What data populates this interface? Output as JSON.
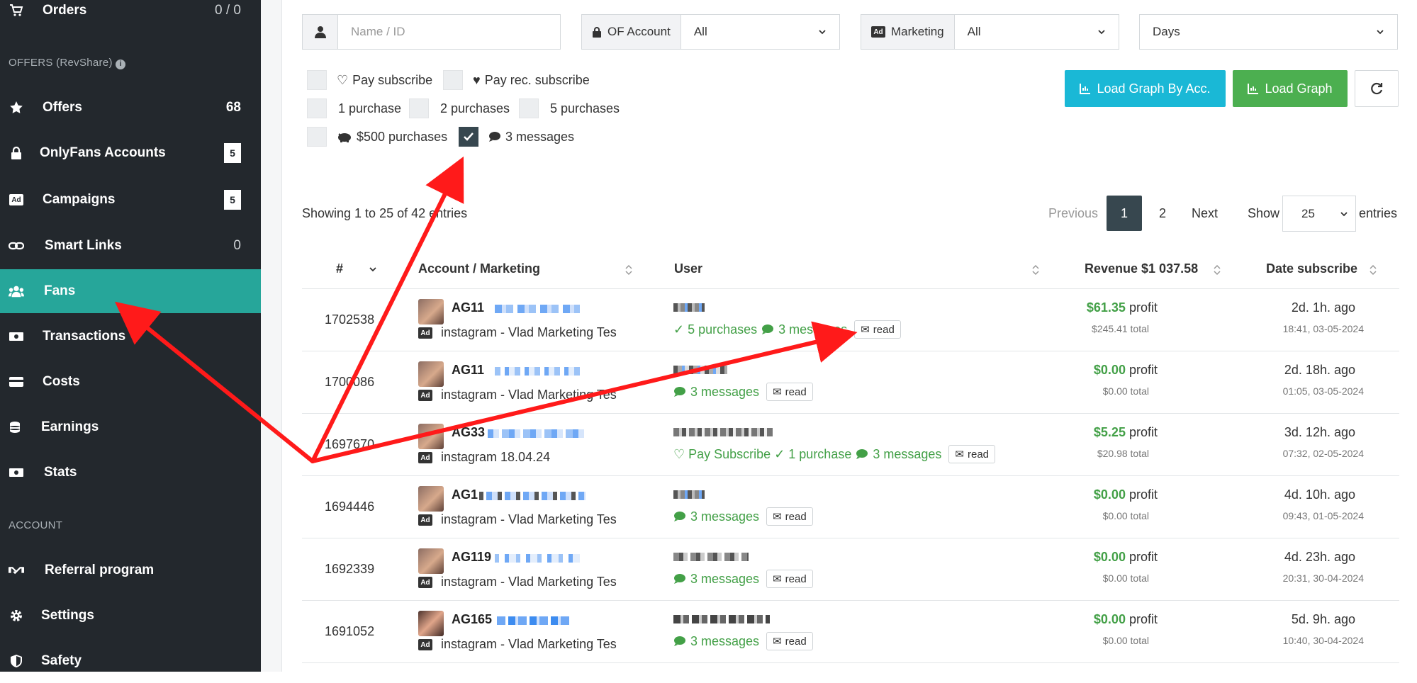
{
  "sidebar": {
    "orders": {
      "label": "Orders",
      "value": "0 / 0"
    },
    "offers_section": "OFFERS (RevShare)",
    "items": [
      {
        "label": "Offers",
        "value": "68"
      },
      {
        "label": "OnlyFans Accounts",
        "badge": "5"
      },
      {
        "label": "Campaigns",
        "badge": "5"
      },
      {
        "label": "Smart Links",
        "value": "0"
      },
      {
        "label": "Fans"
      },
      {
        "label": "Transactions"
      },
      {
        "label": "Costs"
      },
      {
        "label": "Earnings"
      },
      {
        "label": "Stats"
      }
    ],
    "account_section": "ACCOUNT",
    "account_items": [
      {
        "label": "Referral program"
      },
      {
        "label": "Settings"
      },
      {
        "label": "Safety"
      }
    ]
  },
  "filters": {
    "name_placeholder": "Name / ID",
    "of_account_label": "OF Account",
    "of_account_value": "All",
    "marketing_label": "Marketing",
    "marketing_value": "All",
    "days_value": "Days",
    "checkboxes": [
      {
        "label": "Pay subscribe",
        "checked": false
      },
      {
        "label": "Pay rec. subscribe",
        "checked": false
      },
      {
        "label": "1 purchase",
        "checked": false
      },
      {
        "label": "2 purchases",
        "checked": false
      },
      {
        "label": "5 purchases",
        "checked": false
      },
      {
        "label": "$500 purchases",
        "checked": false
      },
      {
        "label": "3 messages",
        "checked": true
      }
    ],
    "load_graph_by_acc": "Load Graph By Acc.",
    "load_graph": "Load Graph"
  },
  "table_info": "Showing 1 to 25 of 42 entries",
  "pager": {
    "previous": "Previous",
    "page1": "1",
    "page2": "2",
    "next": "Next",
    "show": "Show",
    "show_value": "25",
    "entries": "entries"
  },
  "columns": {
    "num": "#",
    "account": "Account / Marketing",
    "user": "User",
    "revenue": "Revenue $1 037.58",
    "date": "Date subscribe"
  },
  "rows": [
    {
      "id": "1702538",
      "account": "AG11",
      "marketing": "instagram - Vlad Marketing Tes",
      "tags": "✓ 5 purchases",
      "msg": "3 messages",
      "read": "read",
      "profit": "$61.35",
      "profit_label": "profit",
      "total": "$245.41 total",
      "ago": "2d. 1h. ago",
      "date": "18:41, 03-05-2024"
    },
    {
      "id": "1700086",
      "account": "AG11",
      "marketing": "instagram - Vlad Marketing Tes",
      "tags": "",
      "msg": "3 messages",
      "read": "read",
      "profit": "$0.00",
      "profit_label": "profit",
      "total": "$0.00 total",
      "ago": "2d. 18h. ago",
      "date": "01:05, 03-05-2024"
    },
    {
      "id": "1697670",
      "account": "AG33",
      "marketing": "instagram 18.04.24",
      "tags": "♡ Pay Subscribe ✓ 1 purchase",
      "msg": "3 messages",
      "read": "read",
      "profit": "$5.25",
      "profit_label": "profit",
      "total": "$20.98 total",
      "ago": "3d. 12h. ago",
      "date": "07:32, 02-05-2024"
    },
    {
      "id": "1694446",
      "account": "AG1",
      "marketing": "instagram - Vlad Marketing Tes",
      "tags": "",
      "msg": "3 messages",
      "read": "read",
      "profit": "$0.00",
      "profit_label": "profit",
      "total": "$0.00 total",
      "ago": "4d. 10h. ago",
      "date": "09:43, 01-05-2024"
    },
    {
      "id": "1692339",
      "account": "AG119",
      "marketing": "instagram - Vlad Marketing Tes",
      "tags": "",
      "msg": "3 messages",
      "read": "read",
      "profit": "$0.00",
      "profit_label": "profit",
      "total": "$0.00 total",
      "ago": "4d. 23h. ago",
      "date": "20:31, 30-04-2024"
    },
    {
      "id": "1691052",
      "account": "AG165",
      "marketing": "instagram - Vlad Marketing Tes",
      "tags": "",
      "msg": "3 messages",
      "read": "read",
      "profit": "$0.00",
      "profit_label": "profit",
      "total": "$0.00 total",
      "ago": "5d. 9h. ago",
      "date": "10:40, 30-04-2024"
    }
  ],
  "colors": {
    "sidebar": "#23282d",
    "active": "#26a69a",
    "cyan_button": "#1ab8d6",
    "green_button": "#4caf50",
    "arrow": "#ff1a1a",
    "tag_green": "#43a047"
  }
}
